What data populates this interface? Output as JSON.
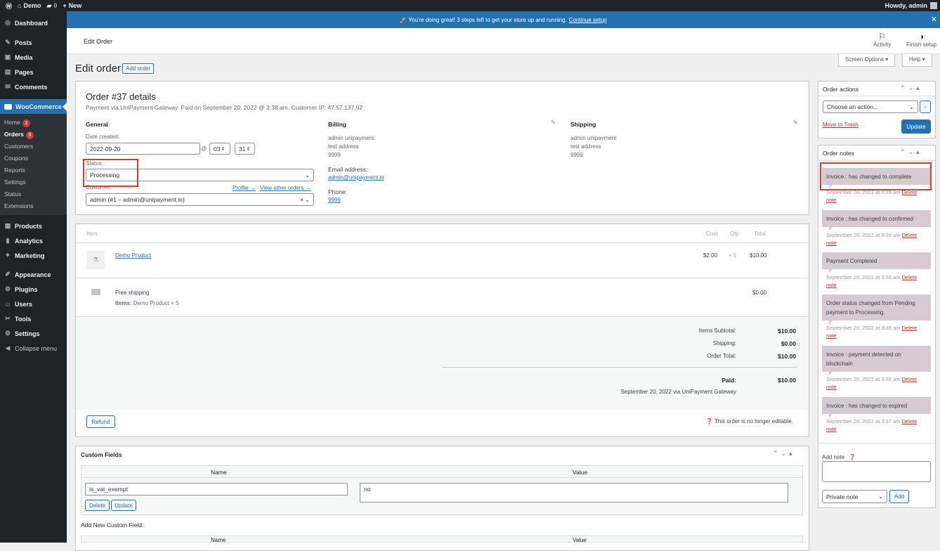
{
  "adminbar": {
    "site": "Demo",
    "comments": "0",
    "new": "New",
    "howdy": "Howdy, admin"
  },
  "sidebar": {
    "items_top": [
      {
        "icon": "◎",
        "label": "Dashboard"
      }
    ],
    "items_mid": [
      {
        "icon": "✎",
        "label": "Posts"
      },
      {
        "icon": "▣",
        "label": "Media"
      },
      {
        "icon": "▤",
        "label": "Pages"
      },
      {
        "icon": "✉",
        "label": "Comments"
      }
    ],
    "woo": "WooCommerce",
    "sub": [
      {
        "label": "Home",
        "badge": "3"
      },
      {
        "label": "Orders",
        "badge": "3"
      },
      {
        "label": "Customers"
      },
      {
        "label": "Coupons"
      },
      {
        "label": "Reports"
      },
      {
        "label": "Settings"
      },
      {
        "label": "Status"
      },
      {
        "label": "Extensions"
      }
    ],
    "items_bottom": [
      {
        "icon": "▦",
        "label": "Products"
      },
      {
        "icon": "▮",
        "label": "Analytics"
      },
      {
        "icon": "✦",
        "label": "Marketing"
      },
      {
        "icon": "✐",
        "label": "Appearance"
      },
      {
        "icon": "⚙",
        "label": "Plugins"
      },
      {
        "icon": "☺",
        "label": "Users"
      },
      {
        "icon": "✂",
        "label": "Tools"
      },
      {
        "icon": "⚙",
        "label": "Settings"
      },
      {
        "icon": "◀",
        "label": "Collapse menu"
      }
    ]
  },
  "notice": {
    "text": "🚀 You're doing great! 3 steps left to get your store up and running.",
    "link": "Continue setup"
  },
  "wcbar": {
    "title": "Edit Order",
    "activity": "Activity",
    "finish": "Finish setup"
  },
  "screen": {
    "options": "Screen Options ▾",
    "help": "Help ▾"
  },
  "page": {
    "title": "Edit order",
    "add": "Add order"
  },
  "order": {
    "heading": "Order #37 details",
    "meta": "Payment via UniPayment Gateway. Paid on September 20, 2022 @ 3:38 am. Customer IP: 47.57.137.92",
    "general": "General",
    "date_label": "Date created:",
    "date": "2022-09-20",
    "at": "@",
    "hour": "03",
    "colon": ":",
    "min": "31",
    "status_label": "Status:",
    "status": "Processing",
    "customer_label": "Customer:",
    "profile": "Profile →",
    "view_other": "View other orders →",
    "customer": "admin (#1 – admin@unipayment.io)",
    "billing": "Billing",
    "billing_addr": [
      "admin unipayment",
      "test address",
      "9999"
    ],
    "email_label": "Email address:",
    "email": "admin@unipayment.io",
    "phone_label": "Phone:",
    "phone": "9999",
    "shipping": "Shipping",
    "shipping_addr": [
      "admin unipayment",
      "test address",
      "9999"
    ]
  },
  "items": {
    "headers": {
      "item": "Item",
      "cost": "Cost",
      "qty": "Qty",
      "total": "Total"
    },
    "product": {
      "name": "Demo Product",
      "cost": "$2.00",
      "qty": "× 5",
      "total": "$10.00"
    },
    "ship": {
      "name": "Free shipping",
      "items_label": "Items:",
      "items": "Demo Product × 5",
      "total": "$0.00"
    },
    "totals": [
      {
        "label": "Items Subtotal:",
        "value": "$10.00"
      },
      {
        "label": "Shipping:",
        "value": "$0.00"
      },
      {
        "label": "Order Total:",
        "value": "$10.00"
      }
    ],
    "paid_label": "Paid:",
    "paid": "$10.00",
    "paid_meta": "September 20, 2022 via UniPayment Gateway",
    "refund": "Refund",
    "not_editable": "This order is no longer editable."
  },
  "custom": {
    "title": "Custom Fields",
    "name": "Name",
    "value": "Value",
    "key": "is_vat_exempt",
    "val": "no",
    "delete": "Delete",
    "update": "Update",
    "add_new": "Add New Custom Field:"
  },
  "actions": {
    "title": "Order actions",
    "choose": "Choose an action...",
    "trash": "Move to Trash",
    "update": "Update"
  },
  "notes": {
    "title": "Order notes",
    "list": [
      {
        "text": "Invoice : has changed to complete",
        "meta": "September 20, 2022 at 3:39 am"
      },
      {
        "text": "Invoice : has changed to confirmed",
        "meta": "September 20, 2022 at 3:38 am"
      },
      {
        "text": "Payment Completed",
        "meta": "September 20, 2022 at 3:38 am"
      },
      {
        "text": "Order status changed from Pending payment to Processing.",
        "meta": "September 20, 2022 at 3:38 am"
      },
      {
        "text": "Invoice : payment detected on blockchain",
        "meta": "September 20, 2022 at 3:38 am"
      },
      {
        "text": "Invoice : has changed to expired",
        "meta": "September 20, 2022 at 3:37 am"
      }
    ],
    "delete": "Delete",
    "note": "note",
    "add_note": "Add note",
    "type": "Private note",
    "add": "Add"
  }
}
